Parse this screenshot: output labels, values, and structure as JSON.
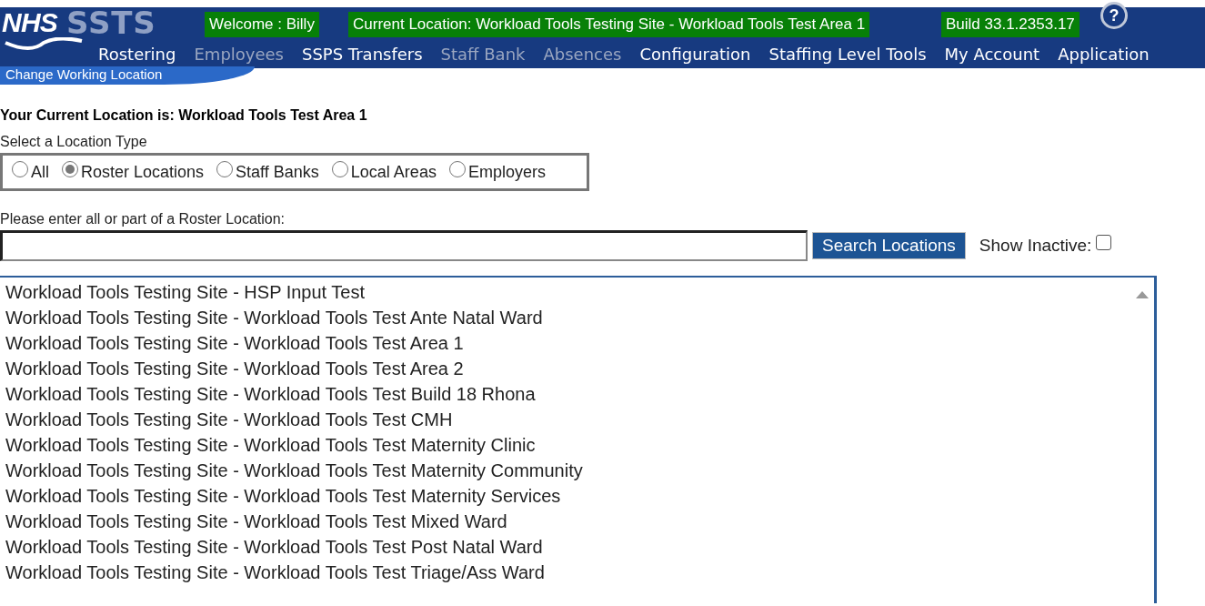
{
  "header": {
    "logo_text": "NHS",
    "product": "SSTS",
    "welcome": "Welcome : Billy",
    "current_location": "Current Location: Workload Tools Testing Site - Workload Tools Test Area 1",
    "build": "Build 33.1.2353.17",
    "help_icon": "?"
  },
  "nav": [
    {
      "label": "Rostering",
      "disabled": false
    },
    {
      "label": "Employees",
      "disabled": true
    },
    {
      "label": "SSPS Transfers",
      "disabled": false
    },
    {
      "label": "Staff Bank",
      "disabled": true
    },
    {
      "label": "Absences",
      "disabled": true
    },
    {
      "label": "Configuration",
      "disabled": false
    },
    {
      "label": "Staffing Level Tools",
      "disabled": false
    },
    {
      "label": "My Account",
      "disabled": false
    },
    {
      "label": "Application",
      "disabled": false
    }
  ],
  "page_tab": "Change Working Location",
  "current_location_heading": "Your Current Location is: Workload Tools Test Area 1",
  "location_type": {
    "label": "Select a Location Type",
    "options": [
      {
        "label": "All",
        "selected": false
      },
      {
        "label": "Roster Locations",
        "selected": true
      },
      {
        "label": "Staff Banks",
        "selected": false
      },
      {
        "label": "Local Areas",
        "selected": false
      },
      {
        "label": "Employers",
        "selected": false
      }
    ]
  },
  "search": {
    "label": "Please enter all or part of a Roster Location:",
    "button": "Search Locations",
    "show_inactive_label": "Show Inactive:",
    "show_inactive_checked": false
  },
  "locations": [
    "Workload Tools Testing Site - HSP Input Test",
    "Workload Tools Testing Site - Workload Tools Test Ante Natal Ward",
    "Workload Tools Testing Site - Workload Tools Test Area 1",
    "Workload Tools Testing Site - Workload Tools Test Area 2",
    "Workload Tools Testing Site - Workload Tools Test Build 18 Rhona",
    "Workload Tools Testing Site - Workload Tools Test CMH",
    "Workload Tools Testing Site - Workload Tools Test Maternity Clinic",
    "Workload Tools Testing Site - Workload Tools Test Maternity Community",
    "Workload Tools Testing Site - Workload Tools Test Maternity Services",
    "Workload Tools Testing Site - Workload Tools Test Mixed Ward",
    "Workload Tools Testing Site - Workload Tools Test Post Natal Ward",
    "Workload Tools Testing Site - Workload Tools Test Triage/Ass Ward"
  ]
}
